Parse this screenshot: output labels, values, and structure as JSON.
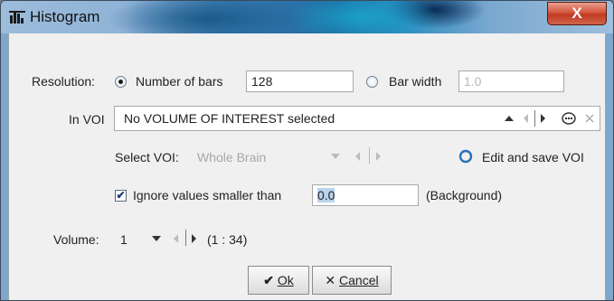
{
  "window": {
    "title": "Histogram",
    "close_label": "X"
  },
  "resolution": {
    "label": "Resolution:",
    "number_of_bars_label": "Number of bars",
    "number_of_bars_value": "128",
    "number_of_bars_selected": true,
    "bar_width_label": "Bar width",
    "bar_width_value": "1.0",
    "bar_width_selected": false
  },
  "voi": {
    "label": "In VOI",
    "value": "No VOLUME OF INTEREST selected",
    "select_label": "Select VOI:",
    "select_value": "Whole Brain",
    "edit_save_label": "Edit and save VOI"
  },
  "ignore": {
    "checked": true,
    "label": "Ignore values smaller than",
    "value": "0.0",
    "suffix": "(Background)"
  },
  "volume": {
    "label": "Volume:",
    "value": "1",
    "range": "(1 : 34)"
  },
  "buttons": {
    "ok_label": "Ok",
    "cancel_label": "Cancel"
  },
  "colors": {
    "close_button": "#c74a32",
    "edit_icon": "#2a6fb8",
    "dialog_bg": "#f0f0f0"
  },
  "icons": {
    "title": "histogram-icon",
    "ok": "check-icon",
    "cancel": "cross-icon",
    "edit_voi": "ring-icon",
    "voi_edit": "ellipsis-icon",
    "voi_clear": "close-icon"
  }
}
